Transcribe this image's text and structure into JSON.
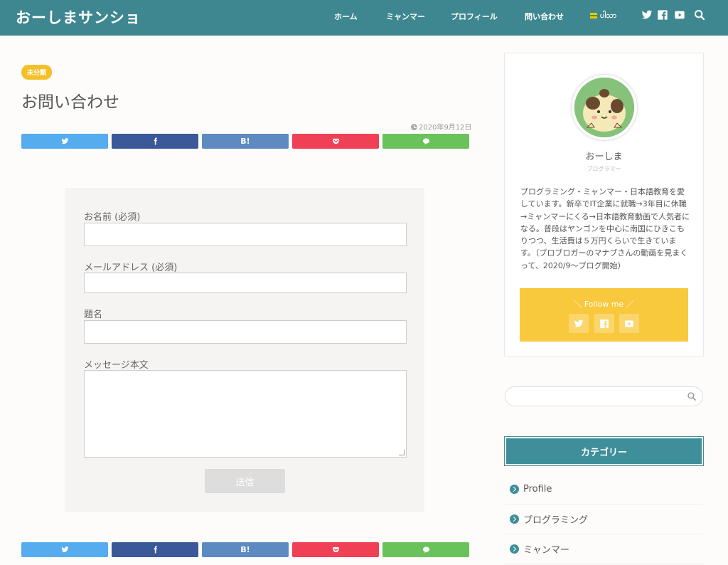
{
  "header": {
    "site_title": "おーしまサンショ",
    "nav": [
      {
        "label": "ホーム"
      },
      {
        "label": "ミャンマー"
      },
      {
        "label": "プロフィール"
      },
      {
        "label": "問い合わせ"
      },
      {
        "label": "ပါသာ"
      }
    ],
    "icons": [
      "twitter-icon",
      "facebook-icon",
      "youtube-icon",
      "search-icon"
    ]
  },
  "article": {
    "category": "未分類",
    "title": "お問い合わせ",
    "date": "2020年9月12日",
    "share_buttons": [
      {
        "name": "twitter",
        "label": "",
        "color": "#55acee"
      },
      {
        "name": "facebook",
        "label": "",
        "color": "#3b5998"
      },
      {
        "name": "hatena",
        "label": "B!",
        "color": "#5d8ac1"
      },
      {
        "name": "pocket",
        "label": "",
        "color": "#ef4056"
      },
      {
        "name": "line",
        "label": "",
        "color": "#6ac25a"
      }
    ]
  },
  "form": {
    "name_label": "お名前 (必須)",
    "email_label": "メールアドレス (必須)",
    "subject_label": "題名",
    "message_label": "メッセージ本文",
    "name_value": "",
    "email_value": "",
    "subject_value": "",
    "message_value": "",
    "submit_label": "送信"
  },
  "sidebar": {
    "profile": {
      "name": "おーしま",
      "role": "プログラマー",
      "bio": "プログラミング・ミャンマー・日本語教育を愛しています。新卒でIT企業に就職→3年目に休職→ミャンマーにくる→日本語教育動画で人気者になる。普段はヤンゴンを中心に南国にひきこもりつつ、生活費は５万円くらいで生きています。（ブロブロガーのマナブさんの動画を見まくって、2020/9〜ブログ開始）",
      "follow_title": "＼ Follow me ／"
    },
    "search": {
      "placeholder": ""
    },
    "categories": {
      "title": "カテゴリー",
      "items": [
        {
          "label": "Profile"
        },
        {
          "label": "プログラミング"
        },
        {
          "label": "ミャンマー"
        }
      ]
    }
  },
  "colors": {
    "header": "#3e8791",
    "accent": "#3e8f9a",
    "badge": "#f4c02a",
    "follow": "#f8c93c"
  }
}
